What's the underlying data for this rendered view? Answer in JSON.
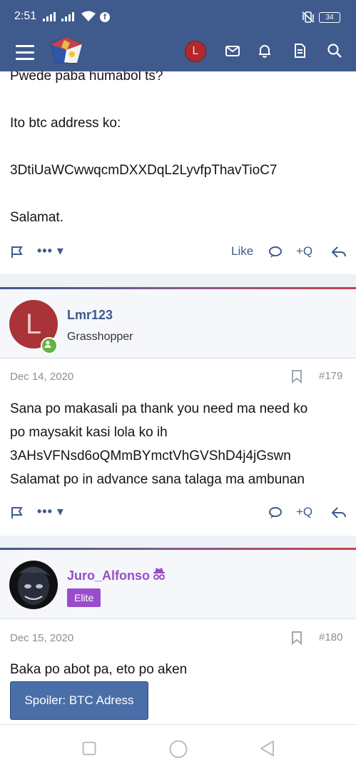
{
  "status_bar": {
    "time": "2:51",
    "battery": "34",
    "icons": [
      "signal-icon",
      "wifi-icon",
      "facebook-icon",
      "vibrate-icon",
      "battery-icon"
    ]
  },
  "header": {
    "avatar_letter": "L",
    "icons": [
      "menu-icon",
      "site-logo",
      "mail-icon",
      "bell-icon",
      "document-icon",
      "search-icon"
    ],
    "colors": {
      "bar": "#3f5a8c",
      "avatar": "#b3282d"
    }
  },
  "posts": [
    {
      "lines": [
        "Pwede paba humabol ts?",
        "",
        "Ito btc address ko:",
        "",
        "3DtiUaWCwwqcmDXXDqL2LyvfpThavTioC7",
        "",
        "Salamat."
      ],
      "actions": {
        "more": "••• ▾",
        "like": "Like",
        "quote": "+Q"
      }
    },
    {
      "username": "Lmr123",
      "user_title": "Grasshopper",
      "avatar_letter": "L",
      "date": "Dec 14, 2020",
      "number": "#179",
      "lines": [
        "Sana po makasali pa thank you need ma need ko",
        "po maysakit kasi lola ko ih",
        "3AHsVFNsd6oQMmBYmctVhGVShD4j4jGswn",
        "Salamat po in advance sana talaga ma ambunan"
      ],
      "actions": {
        "more": "••• ▾",
        "quote": "+Q"
      },
      "colors": {
        "username": "#3f5a8c",
        "online": "#63b343"
      }
    },
    {
      "username": "Juro_Alfonso",
      "badge": "Elite",
      "date": "Dec 15, 2020",
      "number": "#180",
      "lines": [
        "Baka po abot pa, eto po aken"
      ],
      "spoiler_label": "Spoiler: BTC Adress",
      "colors": {
        "username": "#9b4bcb",
        "badge": "#9b4bcb"
      }
    }
  ],
  "nav": {
    "icons": [
      "recents-icon",
      "home-icon",
      "back-icon"
    ]
  }
}
